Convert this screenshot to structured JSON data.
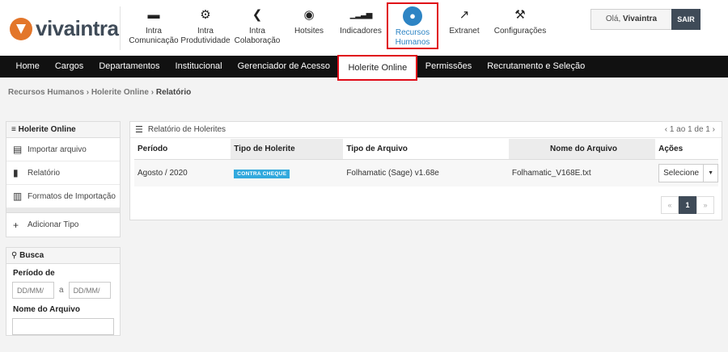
{
  "brand": {
    "name": "vivaintra"
  },
  "topnav": {
    "items": [
      {
        "line1": "Intra",
        "line2": "Comunicação",
        "icon": "chat-icon",
        "glyph": "💬"
      },
      {
        "line1": "Intra",
        "line2": "Produtividade",
        "icon": "gears-icon",
        "glyph": "⚙"
      },
      {
        "line1": "Intra",
        "line2": "Colaboração",
        "icon": "share-icon",
        "glyph": "⋖"
      },
      {
        "line1": "Hotsites",
        "line2": "",
        "icon": "globe-icon",
        "glyph": "◉"
      },
      {
        "line1": "Indicadores",
        "line2": "",
        "icon": "signal-bars-icon",
        "glyph": "▁▂▃▅"
      },
      {
        "line1": "Recursos",
        "line2": "Humanos",
        "icon": "users-icon",
        "glyph": "👥"
      },
      {
        "line1": "Extranet",
        "line2": "",
        "icon": "external-link-icon",
        "glyph": "⧉"
      },
      {
        "line1": "Configurações",
        "line2": "",
        "icon": "wrench-icon",
        "glyph": "🔧"
      }
    ]
  },
  "user": {
    "greeting": "Olá,",
    "name": "Vivaintra",
    "logout": "SAIR"
  },
  "menu": {
    "items": [
      "Home",
      "Cargos",
      "Departamentos",
      "Institucional",
      "Gerenciador de Acesso",
      "Holerite Online",
      "Permissões",
      "Recrutamento e Seleção"
    ],
    "active_index": 5
  },
  "breadcrumb": {
    "part1": "Recursos Humanos",
    "sep": "›",
    "part2": "Holerite Online",
    "current": "Relatório"
  },
  "sidebar": {
    "title": "Holerite Online",
    "items": [
      "Importar arquivo",
      "Relatório",
      "Formatos de Importação"
    ],
    "add_label": "Adicionar Tipo"
  },
  "search": {
    "title": "Busca",
    "period_label": "Período de",
    "date_from_placeholder": "DD/MM/",
    "between": "a",
    "date_to_placeholder": "DD/MM/",
    "filename_label": "Nome do Arquivo",
    "filename_value": ""
  },
  "report": {
    "title": "Relatório de Holerites",
    "pager_text": "1 ao 1 de 1",
    "pager_prev": "‹",
    "pager_next": "›",
    "columns": [
      "Período",
      "Tipo de Holerite",
      "Tipo de Arquivo",
      "Nome do Arquivo",
      "Ações"
    ],
    "rows": [
      {
        "periodo": "Agosto / 2020",
        "tipo": "CONTRA CHEQUE",
        "arquivo_tipo": "Folhamatic (Sage) v1.68e",
        "arquivo_nome": "Folhamatic_V168E.txt",
        "acao": "Selecione"
      }
    ],
    "pagination": {
      "first": "«",
      "current": "1",
      "last": "»"
    }
  },
  "colors": {
    "accent": "#2d84c4",
    "highlight": "#e00a16",
    "dark": "#3f4b58",
    "badge": "#32a9dd"
  }
}
